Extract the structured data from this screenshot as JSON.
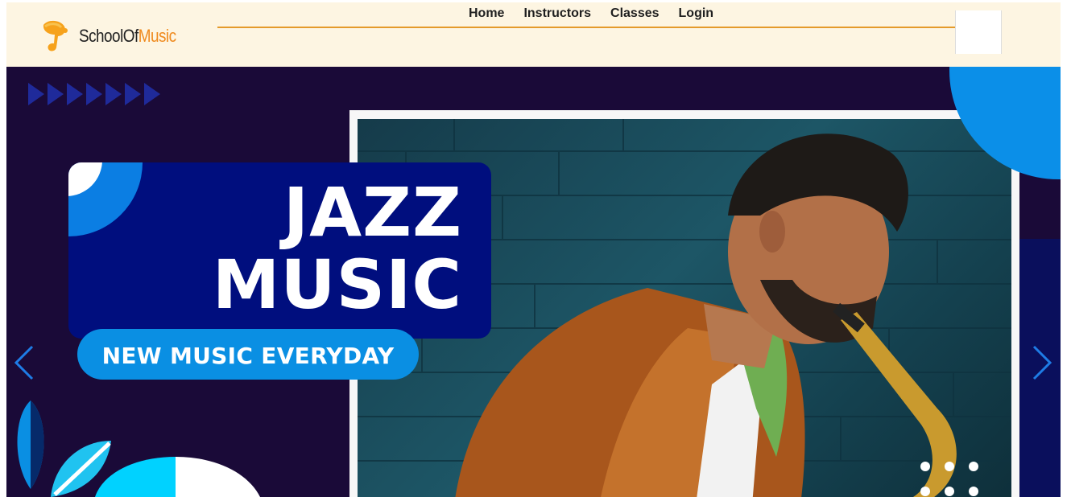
{
  "header": {
    "logo": {
      "name": "SchoolOf",
      "accent": "Music"
    },
    "nav": [
      "Home",
      "Instructors",
      "Classes",
      "Login"
    ]
  },
  "hero": {
    "title_line1": "JAZZ",
    "title_line2": "MUSIC",
    "subtitle": "NEW MUSIC EVERYDAY"
  },
  "colors": {
    "header_bg": "#fdf5e2",
    "accent_orange": "#ef8a1e",
    "banner_bg": "#1a0a38",
    "card_bg": "#000e7e",
    "pill_bg": "#0a8fe3",
    "arrow": "#1e7ce6"
  },
  "icons": {
    "logo": "music-note-logo-icon",
    "prev": "chevron-left-icon",
    "next": "chevron-right-icon"
  }
}
